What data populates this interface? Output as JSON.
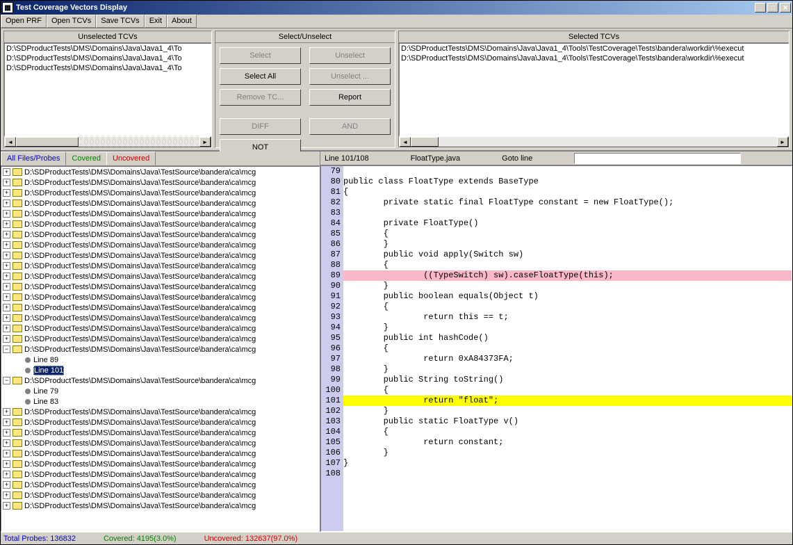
{
  "window": {
    "title": "Test Coverage Vectors Display"
  },
  "menu": [
    "Open PRF",
    "Open TCVs",
    "Save TCVs",
    "Exit",
    "About"
  ],
  "panels": {
    "unselected": {
      "title": "Unselected TCVs",
      "items": [
        "D:\\SDProductTests\\DMS\\Domains\\Java\\Java1_4\\To",
        "D:\\SDProductTests\\DMS\\Domains\\Java\\Java1_4\\To",
        "D:\\SDProductTests\\DMS\\Domains\\Java\\Java1_4\\To"
      ]
    },
    "middle": {
      "title": "Select/Unselect",
      "buttons": [
        {
          "label": "Select",
          "disabled": true
        },
        {
          "label": "Unselect",
          "disabled": true
        },
        {
          "label": "Select All",
          "disabled": false
        },
        {
          "label": "Unselect ...",
          "disabled": true
        },
        {
          "label": "Remove TC...",
          "disabled": true
        },
        {
          "label": "Report",
          "disabled": false
        },
        {
          "label": "DIFF",
          "disabled": true
        },
        {
          "label": "AND",
          "disabled": true
        },
        {
          "label": "NOT",
          "disabled": false
        }
      ]
    },
    "selected": {
      "title": "Selected TCVs",
      "items": [
        "D:\\SDProductTests\\DMS\\Domains\\Java\\Java1_4\\Tools\\TestCoverage\\Tests\\bandera\\workdir\\%execut",
        "D:\\SDProductTests\\DMS\\Domains\\Java\\Java1_4\\Tools\\TestCoverage\\Tests\\bandera\\workdir\\%execut"
      ]
    }
  },
  "tabs": [
    {
      "label": "All Files/Probes",
      "cls": "tab-blue"
    },
    {
      "label": "Covered",
      "cls": "tab-green"
    },
    {
      "label": "Uncovered",
      "cls": "tab-red"
    }
  ],
  "tree_path": "D:\\SDProductTests\\DMS\\Domains\\Java\\TestSource\\bandera\\ca\\mcg",
  "tree_lines": {
    "l89": "Line 89",
    "l101": "Line 101",
    "l79": "Line 79",
    "l83": "Line 83"
  },
  "code_header": {
    "pos": "Line 101/108",
    "file": "FloatType.java",
    "goto": "Goto line"
  },
  "code": [
    {
      "n": 79,
      "t": ""
    },
    {
      "n": 80,
      "t": "public class FloatType extends BaseType"
    },
    {
      "n": 81,
      "t": "{"
    },
    {
      "n": 82,
      "t": "        private static final FloatType constant = new FloatType();"
    },
    {
      "n": 83,
      "t": ""
    },
    {
      "n": 84,
      "t": "        private FloatType()"
    },
    {
      "n": 85,
      "t": "        {"
    },
    {
      "n": 86,
      "t": "        }"
    },
    {
      "n": 87,
      "t": "        public void apply(Switch sw)"
    },
    {
      "n": 88,
      "t": "        {"
    },
    {
      "n": 89,
      "t": "                ((TypeSwitch) sw).caseFloatType(this);",
      "hl": "pink"
    },
    {
      "n": 90,
      "t": "        }"
    },
    {
      "n": 91,
      "t": "        public boolean equals(Object t)"
    },
    {
      "n": 92,
      "t": "        {"
    },
    {
      "n": 93,
      "t": "                return this == t;"
    },
    {
      "n": 94,
      "t": "        }"
    },
    {
      "n": 95,
      "t": "        public int hashCode()"
    },
    {
      "n": 96,
      "t": "        {"
    },
    {
      "n": 97,
      "t": "                return 0xA84373FA;"
    },
    {
      "n": 98,
      "t": "        }"
    },
    {
      "n": 99,
      "t": "        public String toString()"
    },
    {
      "n": 100,
      "t": "        {"
    },
    {
      "n": 101,
      "t": "                return \"float\";",
      "hl": "yellow"
    },
    {
      "n": 102,
      "t": "        }"
    },
    {
      "n": 103,
      "t": "        public static FloatType v()"
    },
    {
      "n": 104,
      "t": "        {"
    },
    {
      "n": 105,
      "t": "                return constant;"
    },
    {
      "n": 106,
      "t": "        }"
    },
    {
      "n": 107,
      "t": "}"
    },
    {
      "n": 108,
      "t": ""
    }
  ],
  "status": {
    "total_label": "Total Probes:",
    "total": "136832",
    "covered_label": "Covered:",
    "covered": "4195(3.0%)",
    "uncovered_label": "Uncovered:",
    "uncovered": "132637(97.0%)"
  }
}
